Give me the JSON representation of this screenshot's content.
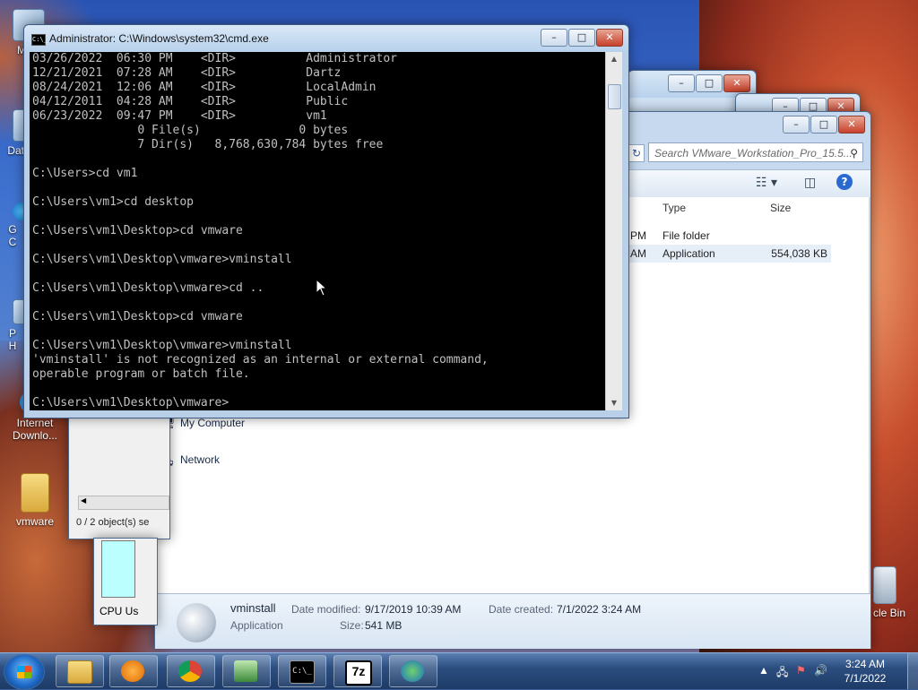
{
  "desktop": {
    "icons": [
      {
        "label": "My C",
        "icon": "computer-icon"
      },
      {
        "label": "Data",
        "icon": "data-icon"
      },
      {
        "label": "G\nC",
        "icon": "chrome-icon"
      },
      {
        "label": "P\nH",
        "icon": "program-icon"
      },
      {
        "label": "Internet Downlo...",
        "icon": "internet-download-manager-icon"
      },
      {
        "label": "vmware",
        "icon": "folder-icon"
      },
      {
        "label": "cle Bin",
        "icon": "recycle-bin-icon"
      }
    ]
  },
  "cmd": {
    "title": "Administrator: C:\\Windows\\system32\\cmd.exe",
    "icon_label": "C:\\_",
    "lines": [
      "03/26/2022  06:30 PM    <DIR>          Administrator",
      "12/21/2021  07:28 AM    <DIR>          Dartz",
      "08/24/2021  12:06 AM    <DIR>          LocalAdmin",
      "04/12/2011  04:28 AM    <DIR>          Public",
      "06/23/2022  09:47 PM    <DIR>          vm1",
      "               0 File(s)              0 bytes",
      "               7 Dir(s)   8,768,630,784 bytes free",
      "",
      "C:\\Users>cd vm1",
      "",
      "C:\\Users\\vm1>cd desktop",
      "",
      "C:\\Users\\vm1\\Desktop>cd vmware",
      "",
      "C:\\Users\\vm1\\Desktop\\vmware>vminstall",
      "",
      "C:\\Users\\vm1\\Desktop\\vmware>cd ..",
      "",
      "C:\\Users\\vm1\\Desktop>cd vmware",
      "",
      "C:\\Users\\vm1\\Desktop\\vmware>vminstall",
      "'vminstall' is not recognized as an internal or external command,",
      "operable program or batch file.",
      "",
      "C:\\Users\\vm1\\Desktop\\vmware>"
    ]
  },
  "explorer": {
    "search_placeholder": "Search VMware_Workstation_Pro_15.5...",
    "columns": {
      "type": "Type",
      "size": "Size"
    },
    "rows": [
      {
        "date_fragment": "PM",
        "type": "File folder",
        "size": ""
      },
      {
        "date_fragment": "AM",
        "type": "Application",
        "size": "554,038 KB"
      }
    ],
    "nav": {
      "my_computer": "My Computer",
      "network": "Network"
    },
    "details": {
      "name": "vminstall",
      "kind": "Application",
      "modified_label": "Date modified:",
      "modified_value": "9/17/2019 10:39 AM",
      "created_label": "Date created:",
      "created_value": "7/1/2022 3:24 AM",
      "size_label": "Size:",
      "size_value": "541 MB"
    }
  },
  "small_window": {
    "status": "0 / 2 object(s) se"
  },
  "cpu_window": {
    "label": "CPU Us"
  },
  "taskbar": {
    "apps": [
      "explorer-icon",
      "media-player-icon",
      "chrome-icon",
      "task-manager-icon",
      "cmd-icon",
      "7zip-icon",
      "internet-download-manager-icon"
    ],
    "sevenzip_label": "7z",
    "cmd_label": "C:\\_",
    "time": "3:24 AM",
    "date": "7/1/2022"
  }
}
